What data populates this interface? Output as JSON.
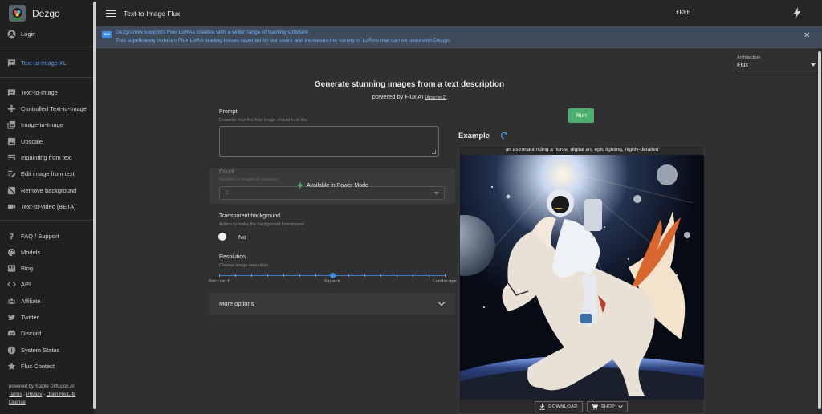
{
  "brand": {
    "name": "Dezgo"
  },
  "sidebar": {
    "login": "Login",
    "featured": "Text-to-Image XL",
    "tools": [
      "Text-to-Image",
      "Controlled Text-to-Image",
      "Image-to-Image",
      "Upscale",
      "Inpainting from text",
      "Edit image from text",
      "Remove background",
      "Text-to-video [BETA]"
    ],
    "links": [
      "FAQ / Support",
      "Models",
      "Blog",
      "API",
      "Affiliate",
      "Twitter",
      "Discord",
      "System Status",
      "Flux Contest"
    ],
    "powered": "powered by Stable Diffusion AI",
    "footer_links": {
      "terms": "Terms",
      "privacy": "Privacy",
      "license": "Open RAIL-M License",
      "sep": " - "
    }
  },
  "topbar": {
    "title": "Text-to-Image Flux",
    "plan": "FREE"
  },
  "banner": {
    "badge": "NEW",
    "line1": "Dezgo now supports Flux LoRAs created with a wider range of training software.",
    "line2": "This significantly reduces Flux LoRA loading issues reported by our users and increases the variety of LoRAs that can be used with Dezgo.",
    "close": "✕"
  },
  "architecture": {
    "label": "Architecture",
    "value": "Flux"
  },
  "hero": {
    "headline": "Generate stunning images from a text description",
    "powered_by": "powered by Flux AI",
    "license": "(Apache 2)"
  },
  "run": {
    "label": "Run"
  },
  "form": {
    "prompt": {
      "label": "Prompt",
      "hint": "Describe how the final image should look like",
      "value": ""
    },
    "count": {
      "label": "Count",
      "hint": "Number of images to generate",
      "value": "1",
      "locked_text": "Available in Power Mode"
    },
    "transparent": {
      "label": "Transparent background",
      "hint": "Addon to make the background transparent",
      "value": "No"
    },
    "resolution": {
      "label": "Resolution",
      "hint": "Choose image resolution",
      "options": [
        "Portrait",
        "Square",
        "Landscape"
      ],
      "selected": "Square"
    },
    "more": "More options"
  },
  "example": {
    "title": "Example",
    "caption": "an astronaut riding a horse, digital art, epic lighting, highly-detailed",
    "download": "DOWNLOAD",
    "shop": "SHOP"
  },
  "colors": {
    "accent": "#5aa0e8",
    "run": "#4caf6f",
    "banner_bg": "#3f4a5b",
    "banner_text": "#6fb3ff"
  }
}
